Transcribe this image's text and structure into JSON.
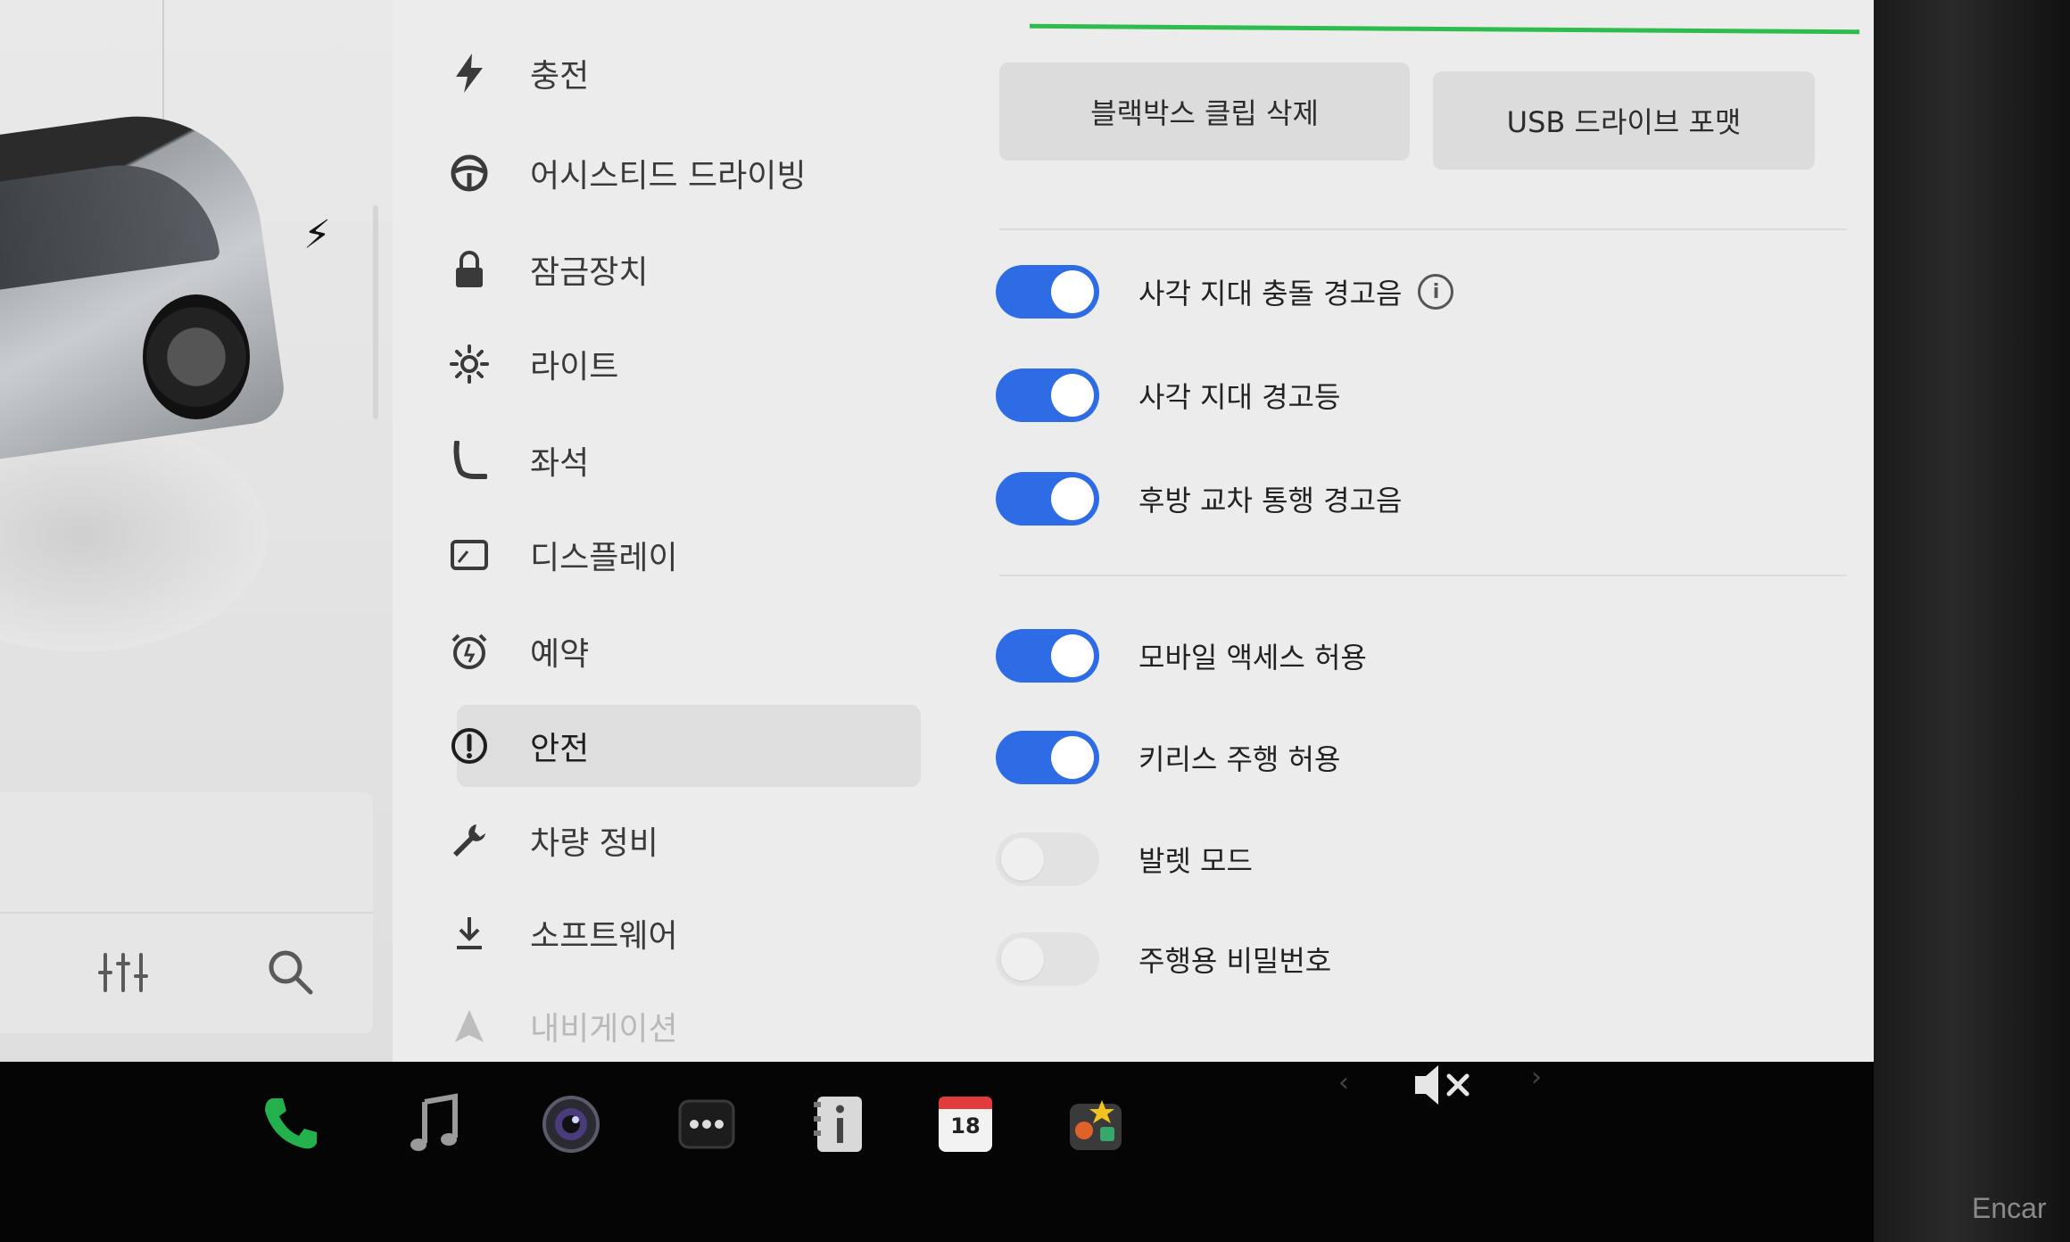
{
  "menu": {
    "items": [
      {
        "label": "충전",
        "icon": "bolt-icon"
      },
      {
        "label": "어시스티드 드라이빙",
        "icon": "steering-wheel-icon"
      },
      {
        "label": "잠금장치",
        "icon": "lock-icon"
      },
      {
        "label": "라이트",
        "icon": "sun-icon"
      },
      {
        "label": "좌석",
        "icon": "seat-icon"
      },
      {
        "label": "디스플레이",
        "icon": "display-icon"
      },
      {
        "label": "예약",
        "icon": "alarm-clock-icon"
      },
      {
        "label": "안전",
        "icon": "alert-circle-icon"
      },
      {
        "label": "차량 정비",
        "icon": "wrench-icon"
      },
      {
        "label": "소프트웨어",
        "icon": "download-icon"
      },
      {
        "label": "내비게이션",
        "icon": "navigation-icon"
      }
    ],
    "active": "안전"
  },
  "actions": {
    "blackbox_clear": "블랙박스 클립 삭제",
    "usb_format": "USB 드라이브 포맷"
  },
  "settings": [
    {
      "label": "사각 지대 충돌 경고음",
      "on": true,
      "info": true
    },
    {
      "label": "사각 지대 경고등",
      "on": true
    },
    {
      "label": "후방 교차 통행 경고음",
      "on": true
    },
    {
      "label": "모바일 액세스 허용",
      "on": true
    },
    {
      "label": "키리스 주행 허용",
      "on": true
    },
    {
      "label": "발렛 모드",
      "on": false
    },
    {
      "label": "주행용 비밀번호",
      "on": false
    }
  ],
  "taskbar": {
    "calendar_day": "18"
  },
  "watermark": "Encar",
  "colors": {
    "toggle_on": "#2e6ce6",
    "charge_bar": "#2ebd4c",
    "phone": "#22b14c"
  }
}
